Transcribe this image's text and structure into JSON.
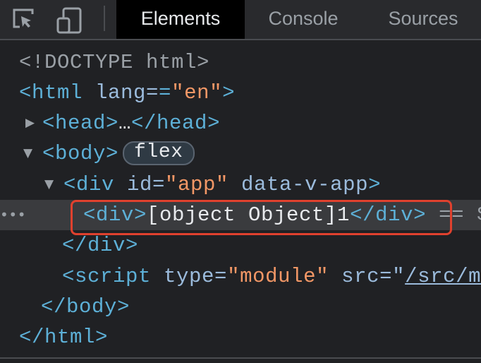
{
  "toolbar": {
    "icons": [
      "inspect-element-icon",
      "device-toolbar-icon"
    ],
    "tabs": [
      {
        "label": "Elements",
        "active": true
      },
      {
        "label": "Console",
        "active": false
      },
      {
        "label": "Sources",
        "active": false
      }
    ]
  },
  "dom": {
    "doctype": "<!DOCTYPE html>",
    "html_open": "<html",
    "html_lang_attr": " lang=",
    "html_lang_val": "\"en\"",
    "gt": ">",
    "head": "<head>",
    "ellipsis": "…",
    "head_close": "</head>",
    "body": "<body>",
    "body_badge": "flex",
    "div_open": "<div",
    "div_id_attr": " id=",
    "div_id_val": "\"app\"",
    "div_data_attr": " data-v-app",
    "div_gt": ">",
    "inner_open": "<div>",
    "inner_text": "[object Object]1",
    "inner_close": "</div>",
    "inner_suffix": " == $",
    "div_close": "</div>",
    "script_open": "<script",
    "script_type_attr": " type=",
    "script_type_val": "\"module\"",
    "script_src_attr": " src=\"",
    "script_src_val": "/src/m",
    "body_close": "</body>",
    "html_close": "</html>",
    "dots": "•••"
  },
  "colors": {
    "tag": "#5db0d7",
    "attr_name": "#9bbbdc",
    "attr_value": "#f29766",
    "highlight_box": "#e0412e"
  }
}
